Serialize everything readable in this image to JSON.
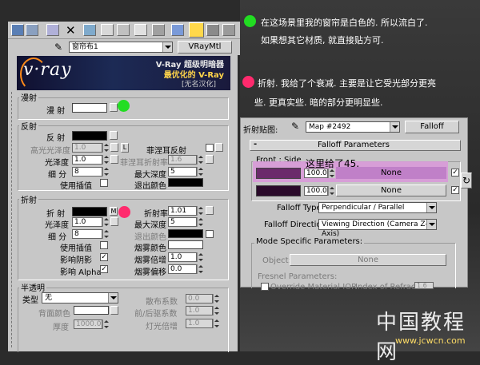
{
  "toolbar": {
    "material_name": "窗帘布1",
    "material_type_button": "VRayMtl",
    "eyedropper_icon": "eyedropper-icon"
  },
  "banner": {
    "line1": "V-Ray 超级明暗器",
    "line2": "最优化的 V-Ray",
    "line3": "[无名汉化]",
    "logo": "v·ray"
  },
  "diffuse": {
    "group_title": "漫射",
    "label": "漫  射",
    "swatch_color": "#ffffff"
  },
  "reflection": {
    "group_title": "反射",
    "label": "反  射",
    "swatch_color": "#000000",
    "hilight_gloss_label": "高光光泽度",
    "hilight_gloss_value": "1.0",
    "lock_label": "L",
    "fresnel_label": "菲涅耳反射",
    "fresnel_ior_label": "菲涅耳折射率",
    "fresnel_ior_value": "1.6",
    "gloss_label": "光泽度",
    "gloss_value": "1.0",
    "subdiv_label": "细  分",
    "subdiv_value": "8",
    "max_depth_label": "最大深度",
    "max_depth_value": "5",
    "interp_label": "使用插值",
    "exit_color_label": "退出颜色",
    "exit_color": "#000000"
  },
  "refraction": {
    "group_title": "折射",
    "label": "折  射",
    "swatch_color": "#000000",
    "map_button": "M",
    "ior_label": "折射率",
    "ior_value": "1.01",
    "gloss_label": "光泽度",
    "gloss_value": "1.0",
    "max_depth_label": "最大深度",
    "max_depth_value": "5",
    "subdiv_label": "细  分",
    "subdiv_value": "8",
    "exit_color_label": "退出颜色",
    "interp_label": "使用插值",
    "fog_color_label": "烟雾颜色",
    "fog_color": "#ffffff",
    "affect_shadows_label": "影响阴影",
    "affect_shadows_checked": "✓",
    "fog_mult_label": "烟雾倍增",
    "fog_mult_value": "1.0",
    "affect_label": "影响 Alpha",
    "affect_checked": "✓",
    "fog_bias_label": "烟雾偏移",
    "fog_bias_value": "0.0"
  },
  "translucency": {
    "group_title": "半透明",
    "type_label": "类型",
    "type_value": "无",
    "back_color_label": "背面颜色",
    "thickness_label": "厚度",
    "thickness_value": "1000.0",
    "scatter_coeff_label": "散布系数",
    "scatter_coeff_value": "0.0",
    "fwd_bck_label": "前/后驱系数",
    "fwd_bck_value": "1.0",
    "light_mult_label": "灯光倍增",
    "light_mult_value": "1.0"
  },
  "notes": {
    "green": "在这场景里我的窗帘是白色的. 所以流白了.",
    "green2": "如果想其它材质, 就直接贴方可.",
    "pink": "折射. 我给了个衰减. 主要是让它受光部分更亮",
    "pink2": "些. 更真实些. 暗的部分更明显些.",
    "colors": {
      "green_dot": "#22dd22",
      "pink_dot": "#ff2a6d"
    }
  },
  "falloff_panel": {
    "map_label": "折射贴图:",
    "map_name": "Map #2492",
    "type_button": "Falloff",
    "rollout_title": "Falloff Parameters",
    "rollout_toggle": "-",
    "front_side_label": "Front : Side",
    "annotation": "这里给了45.",
    "row1_value": "100.0",
    "row1_map": "None",
    "row1_color": "#6b2a6b",
    "row2_value": "100.0",
    "row2_map": "None",
    "row2_color": "#2a0a2a",
    "falloff_type_label": "Falloff Type:",
    "falloff_type_value": "Perpendicular / Parallel",
    "falloff_dir_label": "Falloff Direction:",
    "falloff_dir_value": "Viewing Direction (Camera Z-Axis)",
    "mode_title": "Mode Specific Parameters:",
    "object_label": "Object:",
    "object_value": "None",
    "fresnel_title": "Fresnel Parameters:",
    "override_label": "Override Material IOR",
    "ior_label": "Index of Refraction",
    "ior_value": "1.6"
  },
  "watermark": {
    "title": "中国教程网",
    "url": "www.jcwcn.com"
  }
}
